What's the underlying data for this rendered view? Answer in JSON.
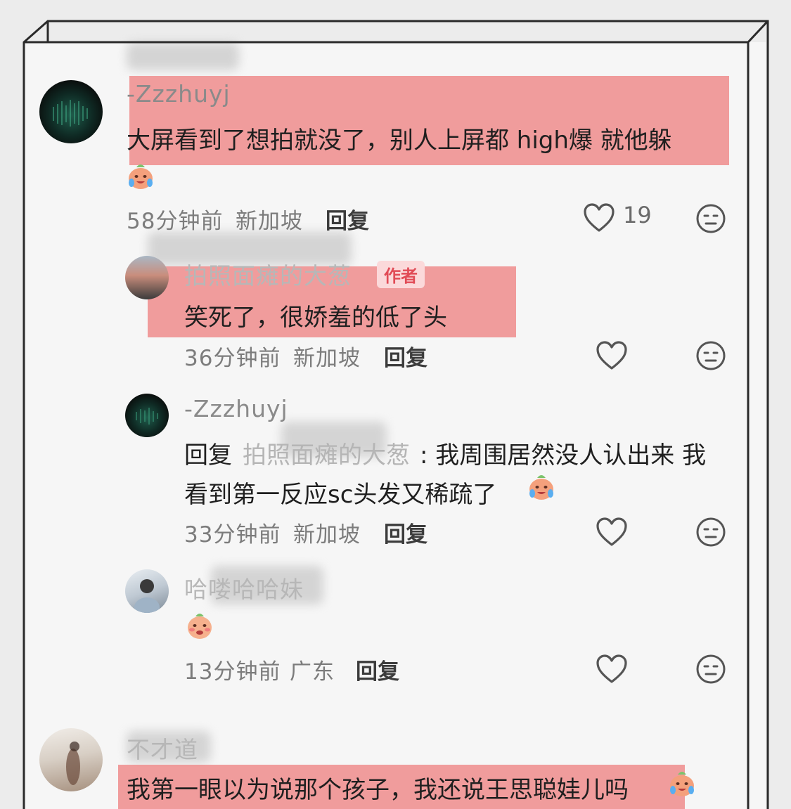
{
  "comments": [
    {
      "username": "-Zzzhuyj",
      "text": "大屏看到了想拍就没了，别人上屏都 high爆 就他躲",
      "time": "58分钟前",
      "location": "新加坡",
      "reply_label": "回复",
      "likes": "19"
    },
    {
      "username": "拍照面瘫的大葱",
      "badge": "作者",
      "text": "笑死了，很娇羞的低了头",
      "time": "36分钟前",
      "location": "新加坡",
      "reply_label": "回复"
    },
    {
      "username": "-Zzzhuyj",
      "reply_prefix": "回复",
      "reply_to": "拍照面瘫的大葱",
      "text_line1": ": 我周围居然没人认出来 我",
      "text_line2": "看到第一反应sc头发又稀疏了",
      "time": "33分钟前",
      "location": "新加坡",
      "reply_label": "回复"
    },
    {
      "username": "哈喽哈哈妹",
      "time": "13分钟前",
      "location": "广东",
      "reply_label": "回复"
    },
    {
      "username": "不才道",
      "text": "我第一眼以为说那个孩子，我还说王思聪娃儿吗"
    }
  ],
  "colors": {
    "highlight": "#ef8f8f",
    "author_badge": "#e14b56",
    "background": "#f6f6f6"
  },
  "icons": [
    "heart-icon",
    "dislike-face-icon",
    "crying-emoji",
    "shy-emoji"
  ]
}
